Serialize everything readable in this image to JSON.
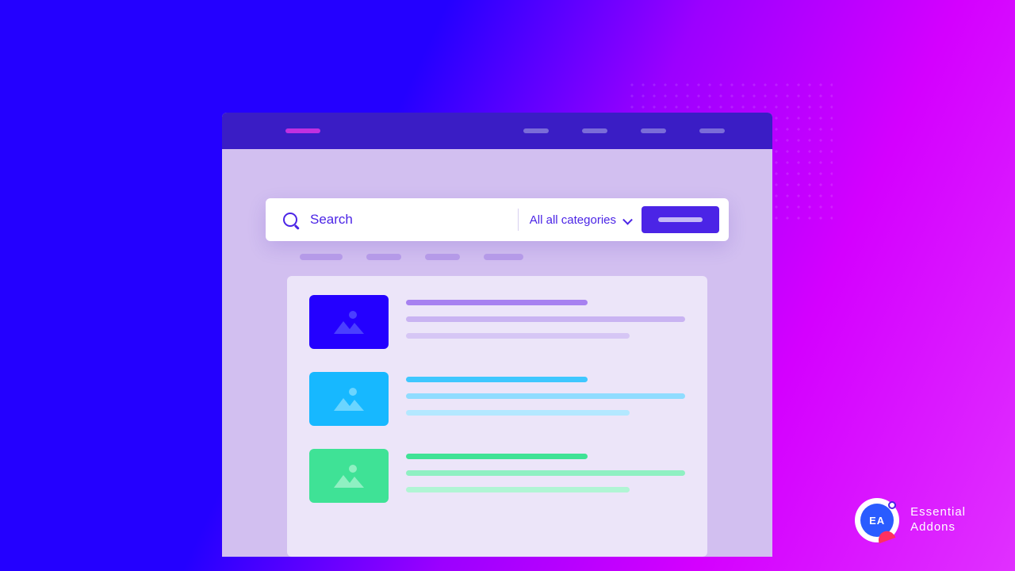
{
  "search": {
    "placeholder": "Search",
    "category_label": "All all categories"
  },
  "badge": {
    "logo_text": "EA",
    "line1": "Essential",
    "line2": "Addons"
  },
  "colors": {
    "primary": "#4b24e6",
    "result1": "#2400ff",
    "result2": "#17b8ff",
    "result3": "#3fe296"
  }
}
